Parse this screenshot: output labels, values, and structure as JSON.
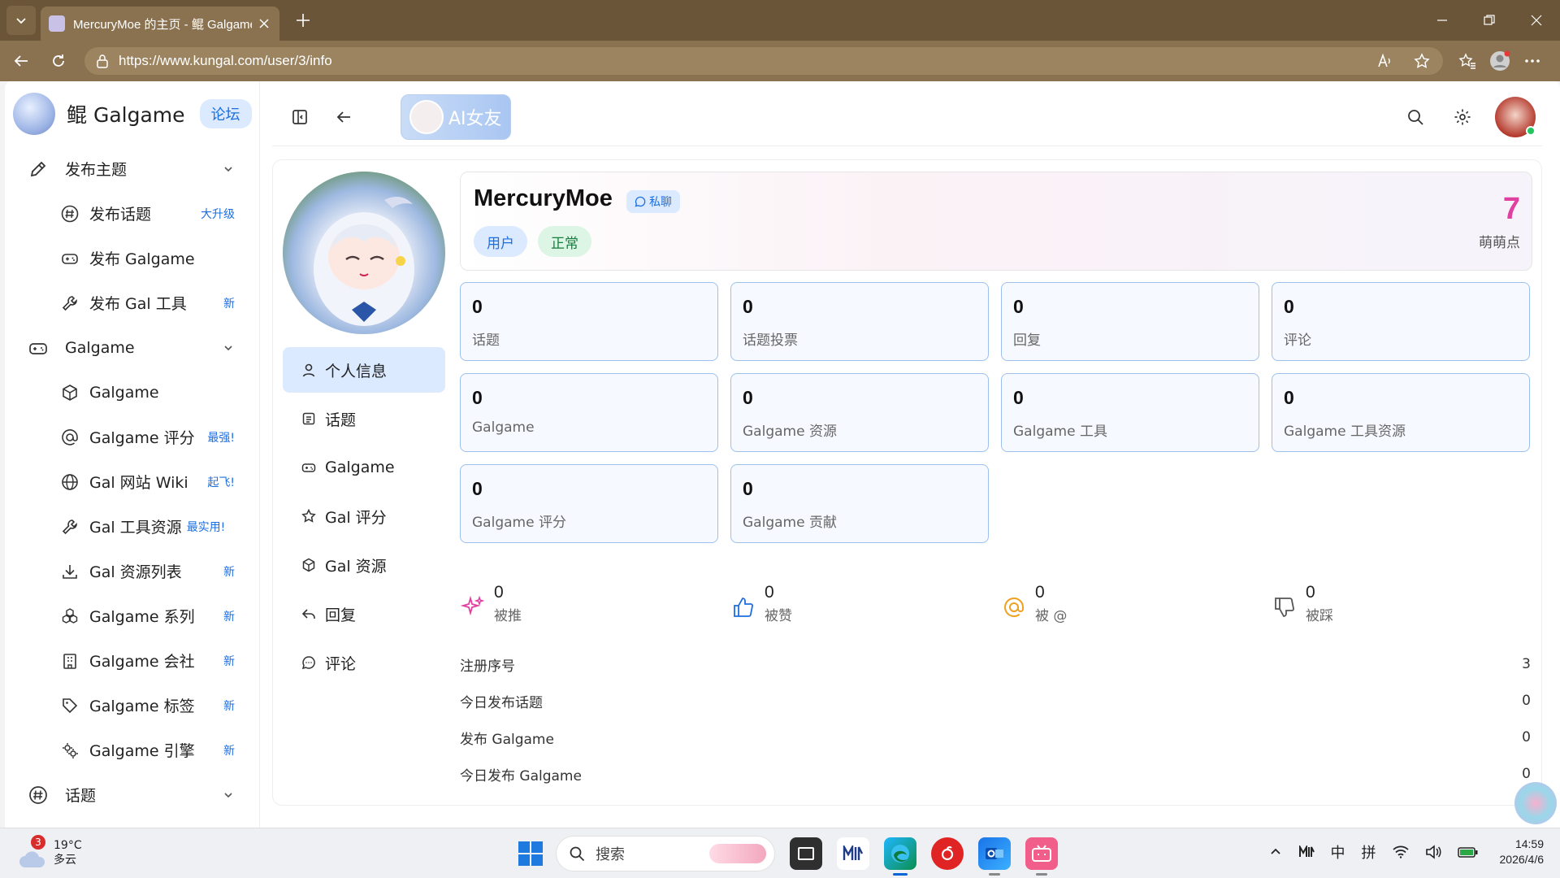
{
  "browser": {
    "tab_title": "MercuryMoe 的主页 - 鲲 Galgame",
    "url": "https://www.kungal.com/user/3/info"
  },
  "sidebar": {
    "brand_name": "鲲 Galgame",
    "brand_tag": "论坛",
    "groups": [
      {
        "label": "发布主题",
        "items": [
          {
            "label": "发布话题",
            "badge": "大升级"
          },
          {
            "label": "发布 Galgame",
            "badge": ""
          },
          {
            "label": "发布 Gal 工具",
            "badge": "新"
          }
        ]
      },
      {
        "label": "Galgame",
        "items": [
          {
            "label": "Galgame",
            "badge": ""
          },
          {
            "label": "Galgame 评分",
            "badge": "最强!"
          },
          {
            "label": "Gal 网站 Wiki",
            "badge": "起飞!"
          },
          {
            "label": "Gal 工具资源",
            "badge": "最实用!"
          },
          {
            "label": "Gal 资源列表",
            "badge": "新"
          },
          {
            "label": "Galgame 系列",
            "badge": "新"
          },
          {
            "label": "Galgame 会社",
            "badge": "新"
          },
          {
            "label": "Galgame 标签",
            "badge": "新"
          },
          {
            "label": "Galgame 引擎",
            "badge": "新"
          }
        ]
      },
      {
        "label": "话题",
        "items": []
      }
    ]
  },
  "topbar": {
    "ai_label": "AI女友"
  },
  "profile": {
    "username": "MercuryMoe",
    "pm_label": "私聊",
    "role": "用户",
    "status": "正常",
    "moemoe_points": "7",
    "moemoe_label": "萌萌点",
    "nav": [
      {
        "label": "个人信息"
      },
      {
        "label": "话题"
      },
      {
        "label": "Galgame"
      },
      {
        "label": "Gal 评分"
      },
      {
        "label": "Gal 资源"
      },
      {
        "label": "回复"
      },
      {
        "label": "评论"
      }
    ],
    "stats": [
      {
        "value": "0",
        "label": "话题"
      },
      {
        "value": "0",
        "label": "话题投票"
      },
      {
        "value": "0",
        "label": "回复"
      },
      {
        "value": "0",
        "label": "评论"
      },
      {
        "value": "0",
        "label": "Galgame"
      },
      {
        "value": "0",
        "label": "Galgame 资源"
      },
      {
        "value": "0",
        "label": "Galgame 工具"
      },
      {
        "value": "0",
        "label": "Galgame 工具资源"
      },
      {
        "value": "0",
        "label": "Galgame 评分"
      },
      {
        "value": "0",
        "label": "Galgame 贡献"
      }
    ],
    "reactions": [
      {
        "value": "0",
        "label": "被推",
        "color": "#e040a0"
      },
      {
        "value": "0",
        "label": "被赞",
        "color": "#1d6fe0"
      },
      {
        "value": "0",
        "label": "被 @",
        "color": "#f0a020"
      },
      {
        "value": "0",
        "label": "被踩",
        "color": "#555555"
      }
    ],
    "info_rows": [
      {
        "label": "注册序号",
        "value": "3"
      },
      {
        "label": "今日发布话题",
        "value": "0"
      },
      {
        "label": "发布 Galgame",
        "value": "0"
      },
      {
        "label": "今日发布 Galgame",
        "value": "0"
      }
    ]
  },
  "taskbar": {
    "weather_badge": "3",
    "temperature": "19°C",
    "weather_desc": "多云",
    "search_placeholder": "搜索",
    "ime1": "中",
    "ime2": "拼",
    "time": "14:59",
    "date": "2026/4/6"
  }
}
